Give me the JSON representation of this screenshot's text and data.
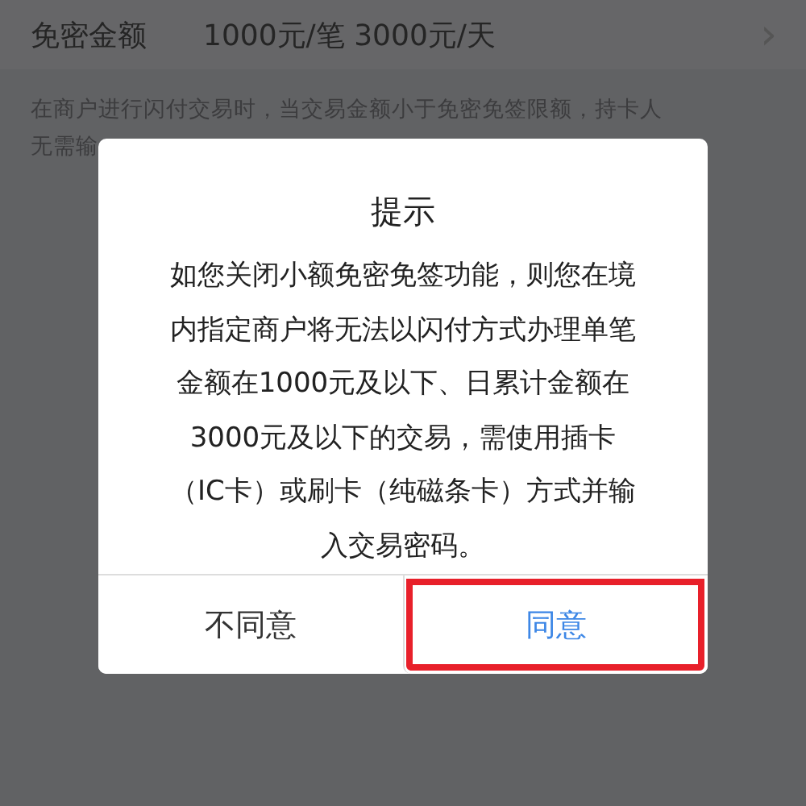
{
  "setting_row": {
    "label": "免密金额",
    "value": "1000元/笔 3000元/天",
    "chevron": "›"
  },
  "description": [
    "在商户进行闪付交易时，当交易金额小于免密免签限额，持卡人",
    "无需输"
  ],
  "dialog": {
    "title": "提示",
    "message": "如您关闭小额免密免签功能，则您在境内指定商户将无法以闪付方式办理单笔金额在1000元及以下、日累计金额在3000元及以下的交易，需使用插卡（IC卡）或刷卡（纯磁条卡）方式并输入交易密码。",
    "buttons": [
      {
        "label": "不同意",
        "kind": "cancel",
        "highlighted": false
      },
      {
        "label": "同意",
        "kind": "confirm",
        "highlighted": true
      }
    ]
  }
}
